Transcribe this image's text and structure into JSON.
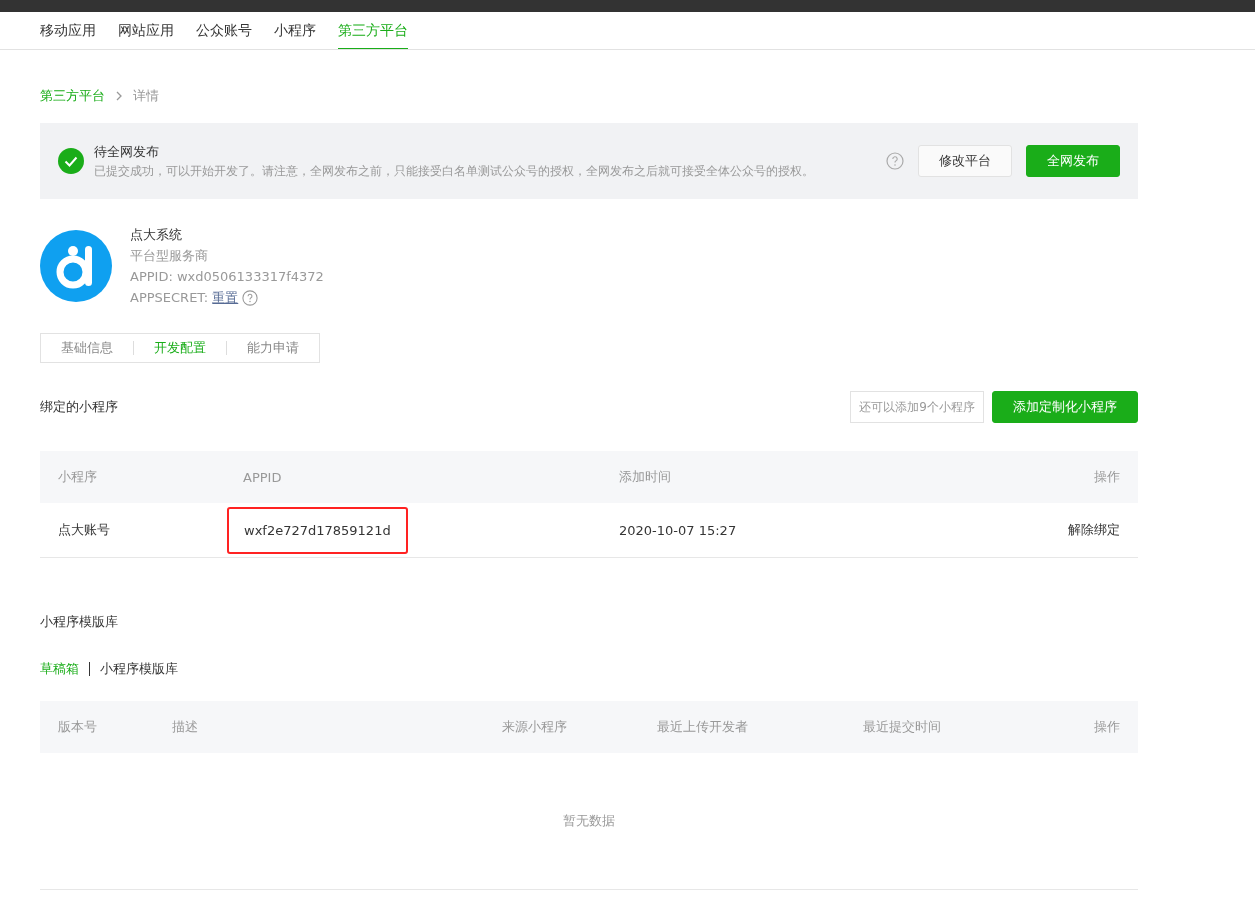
{
  "nav": {
    "tabs": [
      {
        "label": "移动应用",
        "selected": false
      },
      {
        "label": "网站应用",
        "selected": false
      },
      {
        "label": "公众账号",
        "selected": false
      },
      {
        "label": "小程序",
        "selected": false
      },
      {
        "label": "第三方平台",
        "selected": true
      }
    ]
  },
  "breadcrumb": [
    "第三方平台",
    "详情"
  ],
  "notice": {
    "title": "待全网发布",
    "message": "已提交成功，可以开始开发了。请注意，全网发布之前，只能接受白名单测试公众号的授权，全网发布之后就可接受全体公众号的授权。",
    "buttons": [
      {
        "label": "修改平台",
        "kind": "default"
      },
      {
        "label": "全网发布",
        "kind": "primary"
      }
    ]
  },
  "profile": {
    "name": "点大系统",
    "type": "平台型服务商",
    "appid": "APPID: wxd0506133317f4372",
    "secret_label": "APPSECRET:",
    "secret_link": "重置"
  },
  "sub_tabs": [
    {
      "label": "基础信息",
      "selected": false
    },
    {
      "label": "开发配置",
      "selected": true
    },
    {
      "label": "能力申请",
      "selected": false
    }
  ],
  "bound": {
    "title": "绑定的小程序",
    "quota": "还可以添加9个小程序",
    "add_button": "添加定制化小程序",
    "table": {
      "columns": [
        "小程序",
        "APPID",
        "添加时间",
        "操作"
      ],
      "rows": [
        {
          "name": "点大账号",
          "appid": "wxf2e727d17859121d",
          "highlighted": true,
          "added": "2020-10-07 15:27",
          "action": "解除绑定"
        }
      ]
    }
  },
  "templates": {
    "title": "小程序模版库",
    "tabs": [
      {
        "label": "草稿箱",
        "selected": true
      },
      {
        "label": "小程序模版库",
        "selected": false
      }
    ],
    "table": {
      "columns": [
        "版本号",
        "描述",
        "来源小程序",
        "最近上传开发者",
        "最近提交时间",
        "操作"
      ],
      "empty": "暂无数据"
    }
  }
}
